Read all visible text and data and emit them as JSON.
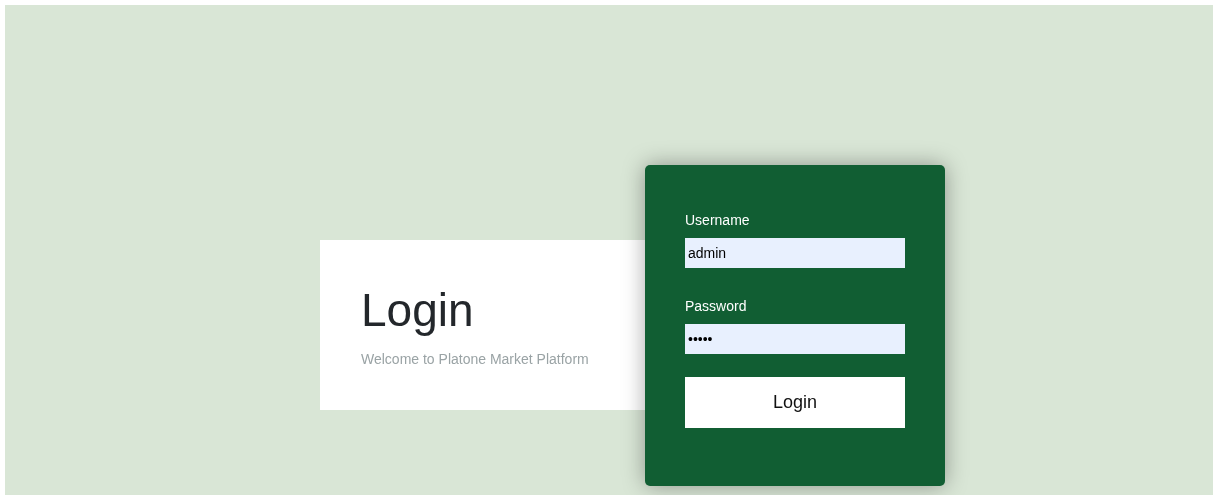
{
  "intro": {
    "title": "Login",
    "subtitle": "Welcome to Platone Market Platform"
  },
  "form": {
    "fields": [
      {
        "label": "Username",
        "value": "admin"
      },
      {
        "label": "Password",
        "value": "•••••"
      }
    ],
    "button": "Login"
  }
}
